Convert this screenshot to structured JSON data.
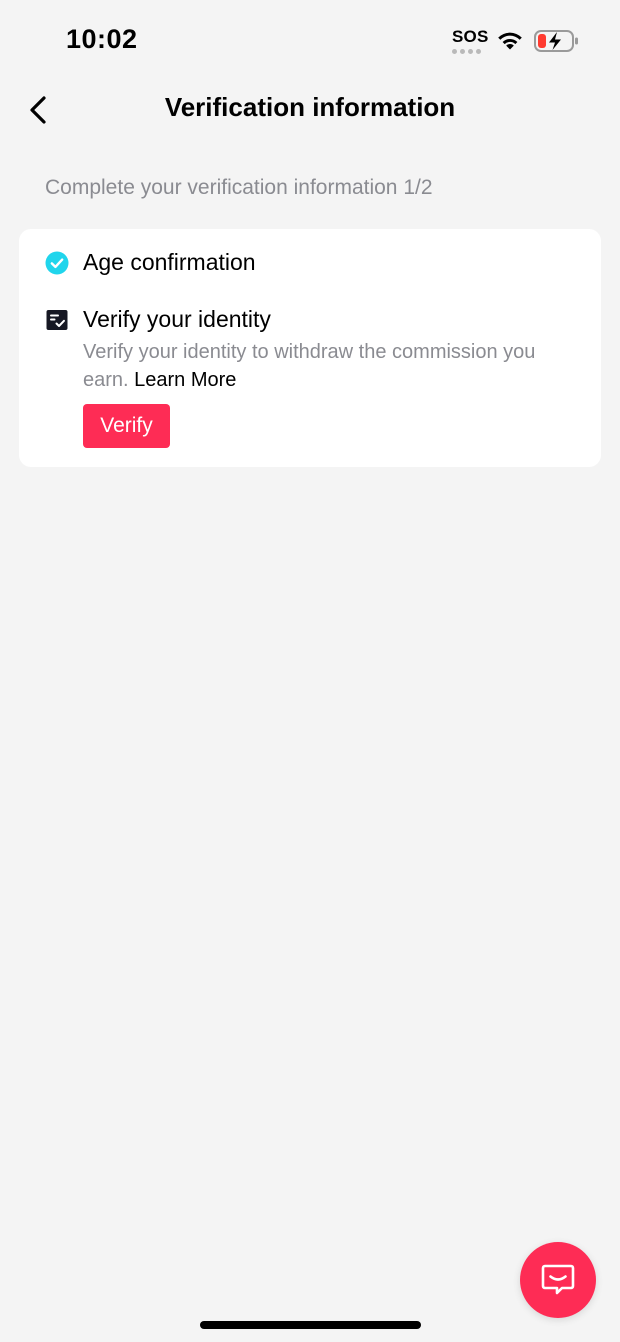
{
  "status_bar": {
    "time": "10:02",
    "sos": "SOS",
    "icons": [
      "wifi-icon",
      "battery-charging-icon"
    ]
  },
  "header": {
    "back_icon": "chevron-left-icon",
    "title": "Verification information"
  },
  "subtitle": "Complete your verification information 1/2",
  "steps": [
    {
      "title": "Age confirmation",
      "icon": "check-circle-icon",
      "status": "complete",
      "icon_color": "#20d5ec"
    },
    {
      "title": "Verify your identity",
      "icon": "id-document-icon",
      "status": "pending",
      "description": "Verify your identity to withdraw the commission you earn.",
      "link_label": "Learn More",
      "button_label": "Verify"
    }
  ],
  "chat_button": {
    "icon": "chat-icon"
  },
  "colors": {
    "accent": "#fe2c55",
    "check": "#20d5ec",
    "background": "#f4f4f4",
    "card": "#ffffff",
    "muted_text": "#8a8b91"
  }
}
